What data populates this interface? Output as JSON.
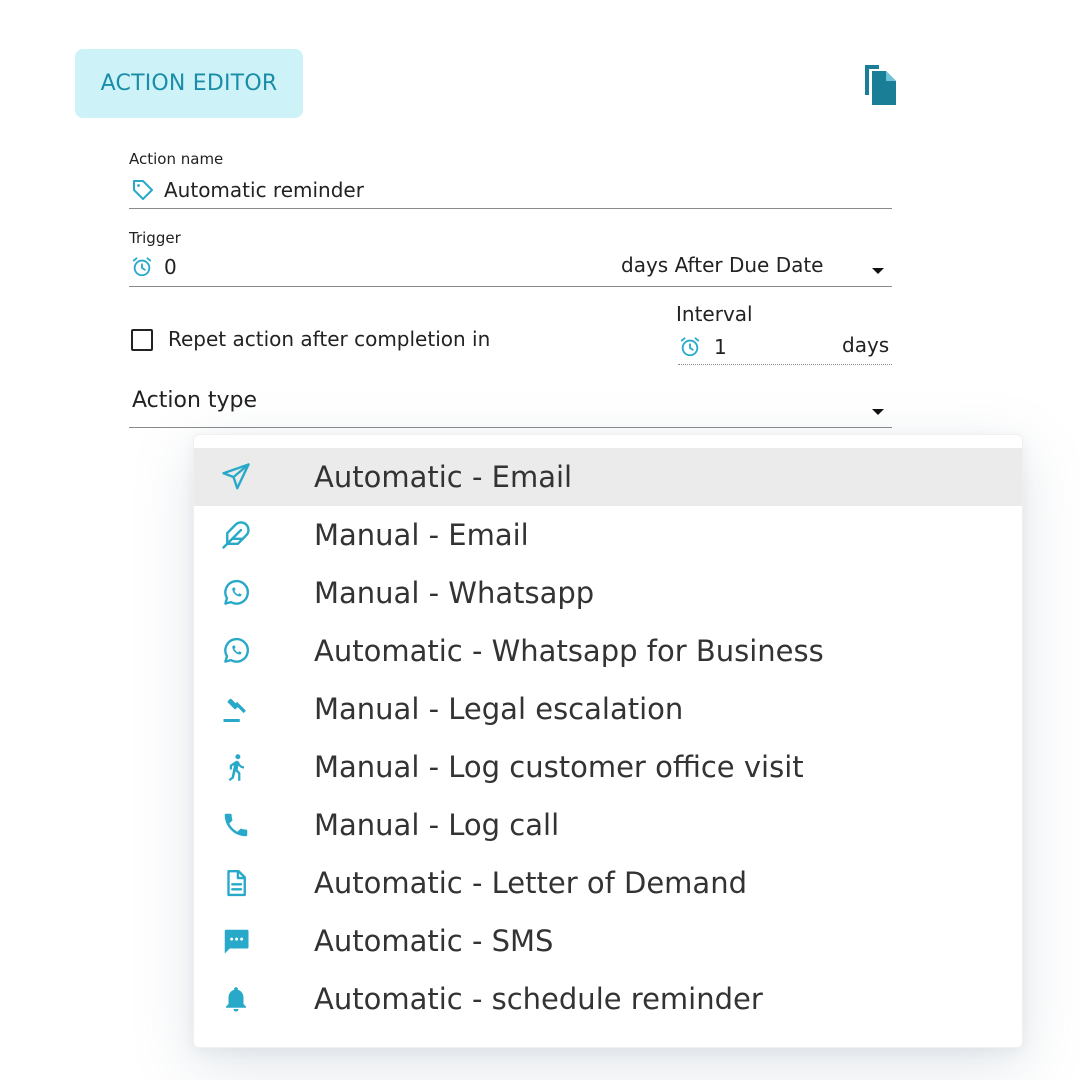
{
  "header": {
    "title": "ACTION EDITOR",
    "copy_icon": "copy-document-icon"
  },
  "form": {
    "action_name": {
      "label": "Action name",
      "value": "Automatic reminder",
      "icon": "tag-icon"
    },
    "trigger": {
      "label": "Trigger",
      "value": "0",
      "icon": "alarm-clock-icon",
      "unit_selected": "days After Due Date"
    },
    "repeat": {
      "checkbox_label": "Repet action after completion in",
      "checked": false
    },
    "interval": {
      "label": "Interval",
      "value": "1",
      "unit": "days",
      "icon": "alarm-clock-icon"
    },
    "action_type": {
      "label": "Action type"
    }
  },
  "dropdown": {
    "items": [
      {
        "label": "Automatic - Email",
        "icon": "send-icon",
        "selected": true
      },
      {
        "label": "Manual - Email",
        "icon": "feather-icon",
        "selected": false
      },
      {
        "label": "Manual - Whatsapp",
        "icon": "whatsapp-icon",
        "selected": false
      },
      {
        "label": "Automatic - Whatsapp for Business",
        "icon": "whatsapp-icon",
        "selected": false
      },
      {
        "label": "Manual - Legal escalation",
        "icon": "gavel-icon",
        "selected": false
      },
      {
        "label": "Manual - Log customer office visit",
        "icon": "walking-person-icon",
        "selected": false
      },
      {
        "label": "Manual - Log call",
        "icon": "phone-icon",
        "selected": false
      },
      {
        "label": "Automatic - Letter of Demand",
        "icon": "document-icon",
        "selected": false
      },
      {
        "label": "Automatic - SMS",
        "icon": "sms-icon",
        "selected": false
      },
      {
        "label": "Automatic - schedule reminder",
        "icon": "bell-icon",
        "selected": false
      }
    ]
  },
  "colors": {
    "accent": "#29a9c9",
    "header_bg": "#cdf2f8",
    "header_text": "#1a8ea8",
    "copy_icon": "#1a7f96"
  }
}
